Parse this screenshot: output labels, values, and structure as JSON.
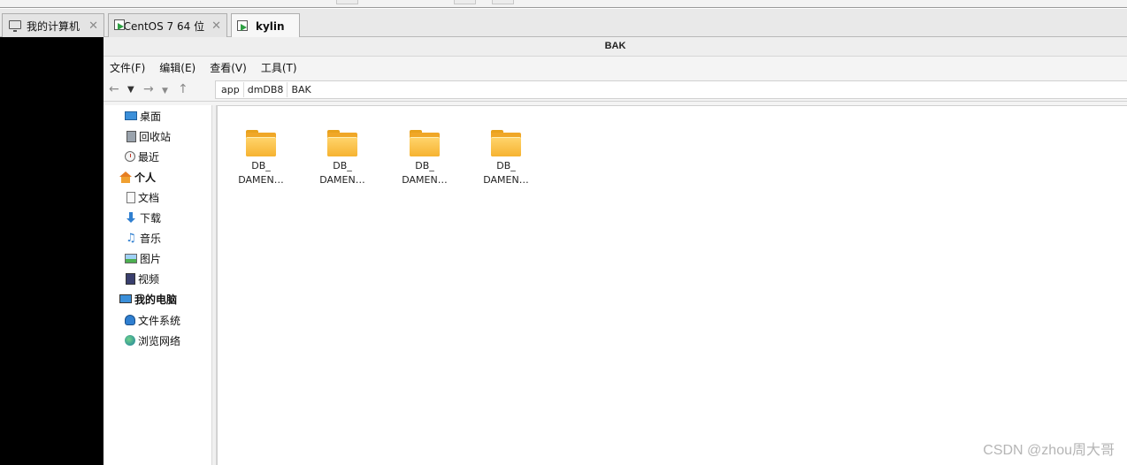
{
  "vm_tabs": [
    {
      "label": "我的计算机",
      "icon": "monitor-icon",
      "active": false
    },
    {
      "label": "CentOS 7 64 位",
      "icon": "vm-icon",
      "active": false
    },
    {
      "label": "kylin",
      "icon": "vm-icon",
      "active": true
    }
  ],
  "tab_close": "✕",
  "window": {
    "title": "BAK"
  },
  "menu": [
    "文件(F)",
    "编辑(E)",
    "查看(V)",
    "工具(T)"
  ],
  "nav": {
    "back": "←",
    "dropdown": "▼",
    "forward": "→",
    "up": "↑"
  },
  "breadcrumb": [
    "app",
    "dmDB8",
    "BAK"
  ],
  "sidebar": {
    "items": [
      {
        "label": "桌面",
        "icon": "desktop-icon",
        "section": false
      },
      {
        "label": "回收站",
        "icon": "trash-icon",
        "section": false
      },
      {
        "label": "最近",
        "icon": "recent-icon",
        "section": false
      },
      {
        "label": "个人",
        "icon": "home-icon",
        "section": true
      },
      {
        "label": "文档",
        "icon": "document-icon",
        "section": false
      },
      {
        "label": "下载",
        "icon": "download-icon",
        "section": false
      },
      {
        "label": "音乐",
        "icon": "music-icon",
        "section": false
      },
      {
        "label": "图片",
        "icon": "picture-icon",
        "section": false
      },
      {
        "label": "视频",
        "icon": "video-icon",
        "section": false
      },
      {
        "label": "我的电脑",
        "icon": "computer-icon",
        "section": true
      },
      {
        "label": "文件系统",
        "icon": "filesystem-icon",
        "section": false
      },
      {
        "label": "浏览网络",
        "icon": "network-icon",
        "section": false
      }
    ]
  },
  "folders": [
    {
      "line1": "DB_",
      "line2": "DAMEN…"
    },
    {
      "line1": "DB_",
      "line2": "DAMEN…"
    },
    {
      "line1": "DB_",
      "line2": "DAMEN…"
    },
    {
      "line1": "DB_",
      "line2": "DAMEN…"
    }
  ],
  "watermark": "CSDN @zhou周大哥"
}
